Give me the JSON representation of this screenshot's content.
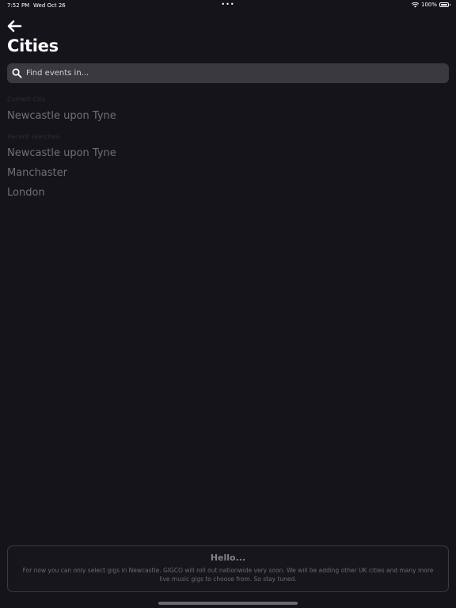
{
  "status_bar": {
    "time": "7:52 PM",
    "date": "Wed Oct 26",
    "dots": "•••",
    "battery": "100%"
  },
  "header": {
    "back_icon": "arrow-left-icon",
    "title": "Cities"
  },
  "search": {
    "icon": "search-icon",
    "placeholder": "Find events in...",
    "value": ""
  },
  "current_city": {
    "label": "Current City",
    "city": "Newcastle upon Tyne"
  },
  "recent_searches": {
    "label": "Recent searches",
    "items": [
      "Newcastle upon Tyne",
      "Manchaster",
      "London"
    ]
  },
  "info_card": {
    "title": "Hello...",
    "body": "For now you can only select gigs in Newcastle. GIGCO will roll out nationwide very soon. We will be adding other UK cities and many more live music gigs to choose from. So stay tuned."
  },
  "colors": {
    "background": "#15141b",
    "search_bg": "#3a393e",
    "city_text": "#706f75"
  }
}
